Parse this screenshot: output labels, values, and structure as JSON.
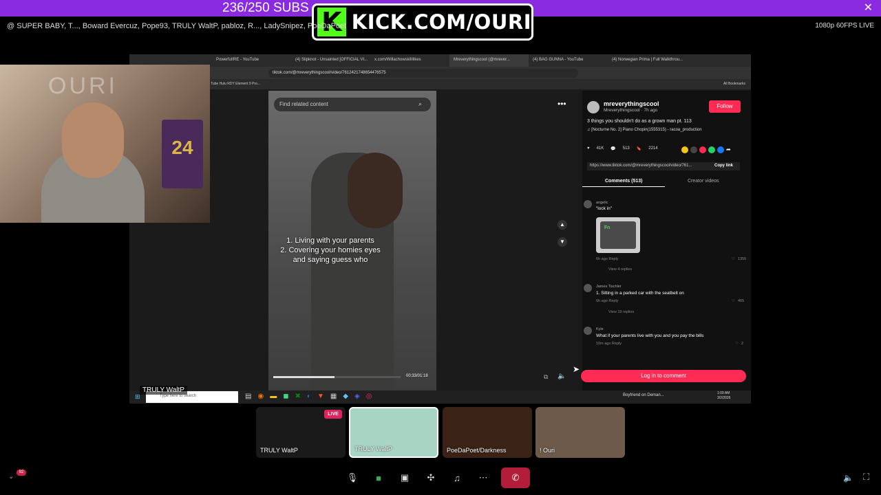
{
  "banner": {
    "subs": "236/250 SUBS",
    "kick_k": "K",
    "kick_text": "KICK.COM/OURI",
    "close": "✕"
  },
  "participants": "SUPER BABY, T..., Boward Evercuz, Pope93, TRULY WaltP, pabloz, R..., LadySnipez, PoeDaPoet",
  "quality": "1080p 60FPS  LIVE",
  "browser": {
    "tabs": [
      "PowerfulIRE - YouTube",
      "(4) Slipknot - Unsainted [OFFICIAL VI...",
      "x.com/WillachowskiMikes",
      "Mreverythingscool (@mrever...",
      "(4) BAG GUNNA - YouTube",
      "(4) Norwegian Prima | Full Walkthrou..."
    ],
    "url": "tiktok.com/@mreverythingscool/video/7612421748654476575",
    "bookmarks": "Tube   Hulu   RDY Element 9 Pro...",
    "all_bookmarks": "All Bookmarks"
  },
  "video": {
    "search_placeholder": "Find related content",
    "caption": "1. Living with your parents\n2. Covering your homies eyes and saying guess who",
    "timestamp": "00:33/01:18",
    "progress_pct": 48
  },
  "panel": {
    "author": "mreverythingscool",
    "author_sub": "Mreverythingscool · 7h ago",
    "follow": "Follow",
    "description": "3 things you shouldn't do as a grown man pt. 113",
    "music": "♫  [Nocturne No. 2] Piano Chopin(1555315) - racoa_production",
    "likes": "41K",
    "comments_count": "513",
    "saves": "2214",
    "link": "https://www.tiktok.com/@mreverythingscool/video/761...",
    "copy_link": "Copy link",
    "tab_comments": "Comments (513)",
    "tab_creator": "Creator videos",
    "comments": [
      {
        "name": "angelic",
        "text": "\"lock in\"",
        "meta": "6h ago   Reply",
        "likes": "1356",
        "replies": "View 4 replies"
      },
      {
        "name": "James Tischler",
        "text": "1. Sitting in a parked car with the seatbelt on",
        "meta": "6h ago   Reply",
        "likes": "465",
        "replies": "View 19 replies"
      },
      {
        "name": "Kyle",
        "text": "What if your parents live with you and you pay the bills",
        "meta": "10m ago   Reply",
        "likes": "2",
        "replies": ""
      }
    ],
    "fn_key": "Fn",
    "login": "Log in to comment"
  },
  "taskbar": {
    "search": "Type here to search",
    "tray": "Boyfriend on Deman...",
    "time": "1:09 AM",
    "date": "3/2/2026"
  },
  "webcam": {
    "sign": "OURI",
    "jersey": "24",
    "name": "TRULY WaltP"
  },
  "tiles": [
    {
      "label": "TRULY WaltP",
      "live": "LIVE"
    },
    {
      "label": "TRULY WaltP"
    },
    {
      "label": "PoeDaPoet/Darkness"
    },
    {
      "label": "! Ouri"
    }
  ],
  "notif_count": "92"
}
